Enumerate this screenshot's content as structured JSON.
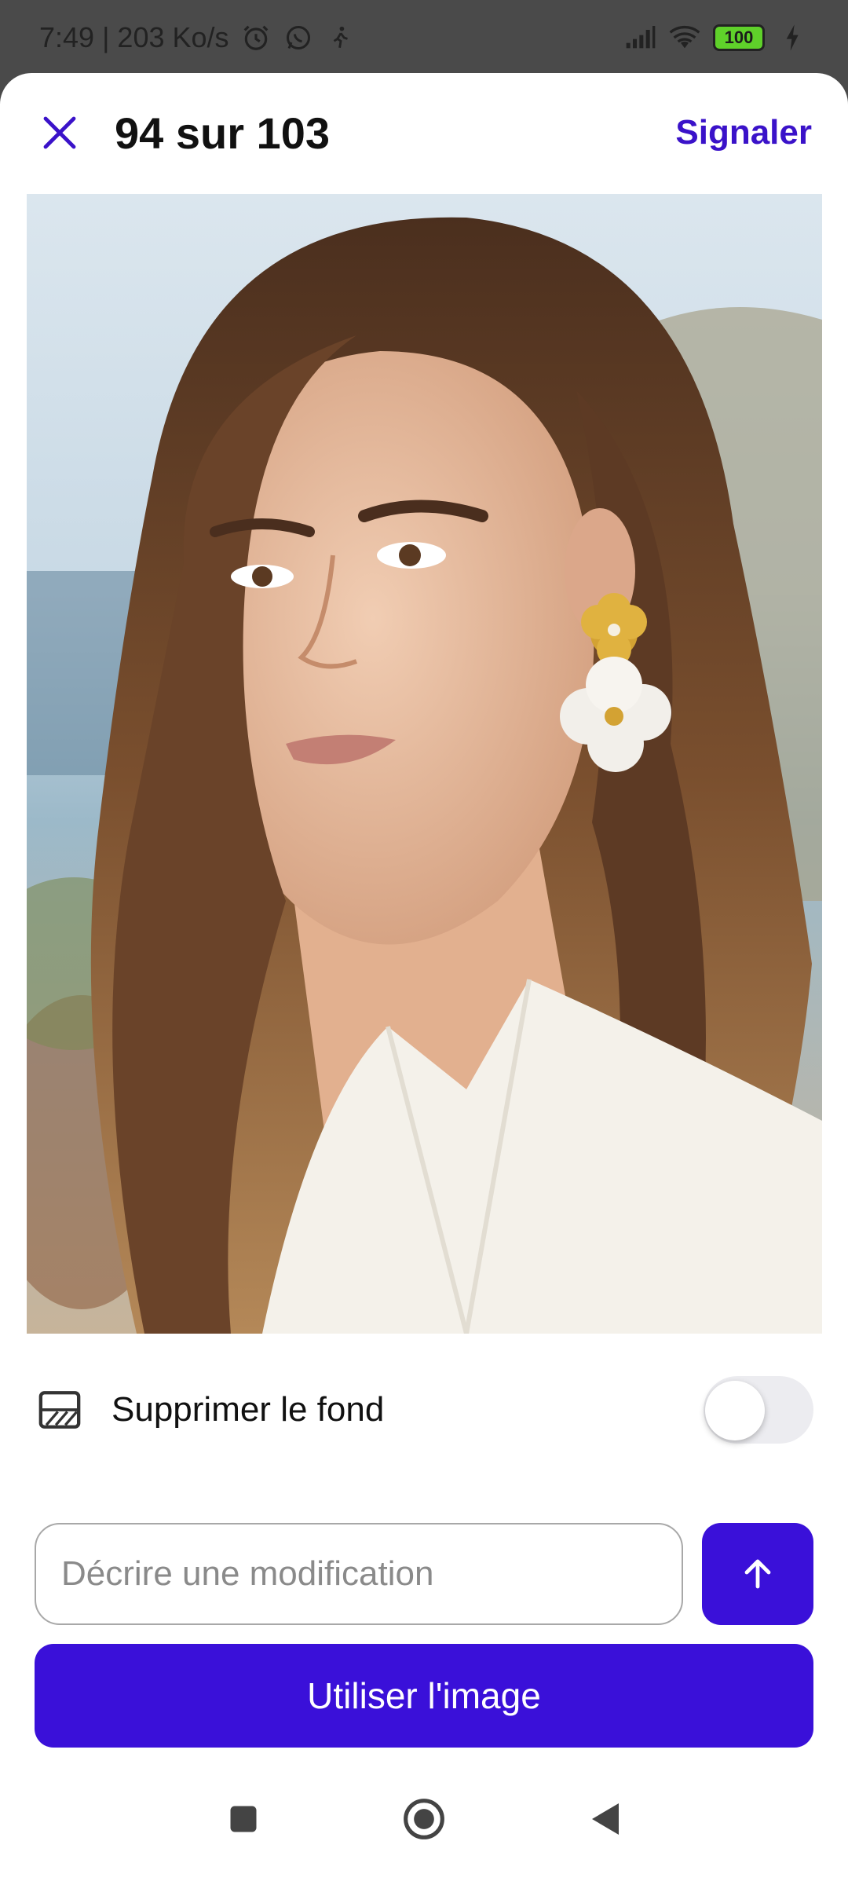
{
  "status_bar": {
    "time_speed": "7:49 | 203 Ko/s",
    "battery": "100",
    "icons": [
      "alarm-icon",
      "whatsapp-icon",
      "walking-icon",
      "signal-icon",
      "wifi-icon",
      "battery-icon",
      "charging-icon"
    ]
  },
  "header": {
    "title": "94 sur 103",
    "report_label": "Signaler",
    "close_icon": "close-icon"
  },
  "remove_background": {
    "label": "Supprimer le fond",
    "enabled": false
  },
  "prompt": {
    "placeholder": "Décrire une modification",
    "value": ""
  },
  "actions": {
    "use_image_label": "Utiliser l'image"
  },
  "colors": {
    "accent": "#3a10d9",
    "accent_text": "#3a12c9"
  }
}
